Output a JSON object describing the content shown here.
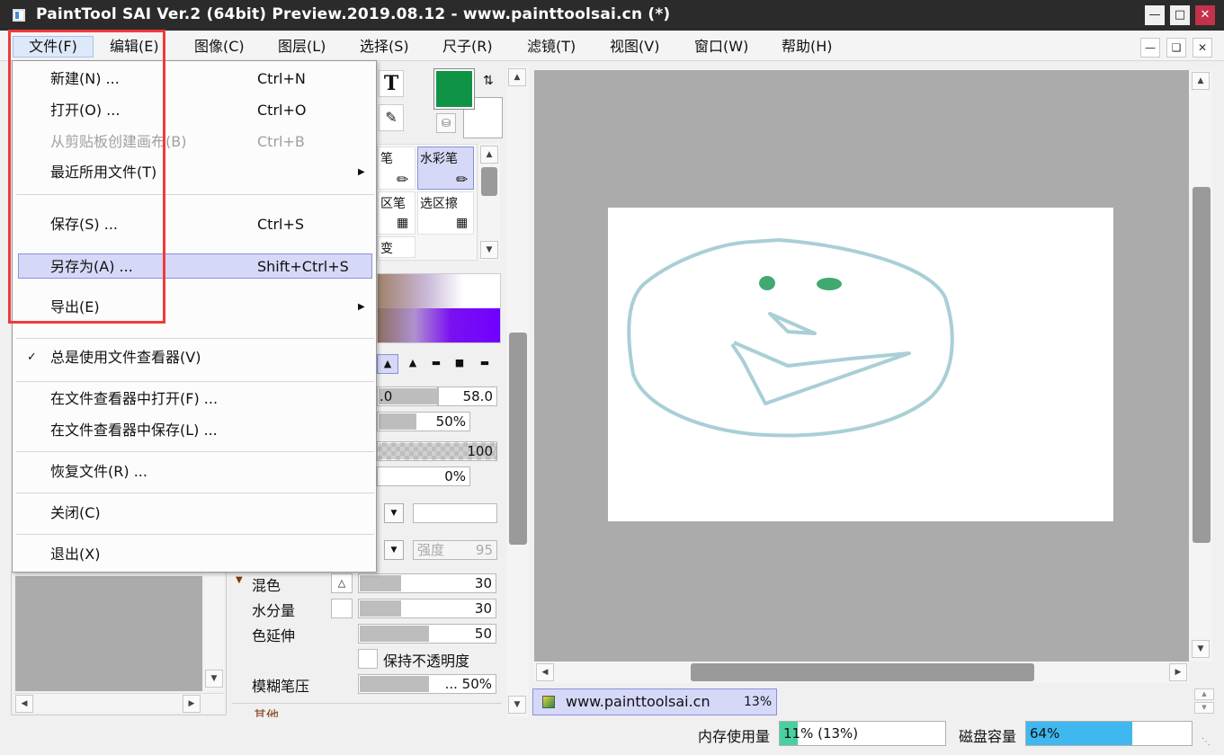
{
  "window": {
    "title": "PaintTool SAI Ver.2 (64bit) Preview.2019.08.12 - www.painttoolsai.cn (*)"
  },
  "menubar": {
    "items": [
      "文件(F)",
      "编辑(E)",
      "图像(C)",
      "图层(L)",
      "选择(S)",
      "尺子(R)",
      "滤镜(T)",
      "视图(V)",
      "窗口(W)",
      "帮助(H)"
    ]
  },
  "file_menu": {
    "new": {
      "label": "新建(N) ...",
      "shortcut": "Ctrl+N"
    },
    "open": {
      "label": "打开(O) ...",
      "shortcut": "Ctrl+O"
    },
    "from_clipboard": {
      "label": "从剪贴板创建画布(B)",
      "shortcut": "Ctrl+B"
    },
    "recent": {
      "label": "最近所用文件(T)"
    },
    "save": {
      "label": "保存(S) ...",
      "shortcut": "Ctrl+S"
    },
    "save_as": {
      "label": "另存为(A) ...",
      "shortcut": "Shift+Ctrl+S"
    },
    "export": {
      "label": "导出(E)"
    },
    "always_viewer": {
      "label": "总是使用文件查看器(V)",
      "checked": true
    },
    "open_in_viewer": {
      "label": "在文件查看器中打开(F) ..."
    },
    "save_in_viewer": {
      "label": "在文件查看器中保存(L) ..."
    },
    "recover": {
      "label": "恢复文件(R) ..."
    },
    "close": {
      "label": "关闭(C)"
    },
    "quit": {
      "label": "退出(X)"
    }
  },
  "tools": {
    "text_tool": "T",
    "brush_partial_1": "笔",
    "watercolor": "水彩笔",
    "select_pen_partial": "区笔",
    "select_eraser": "选区擦",
    "partial_3": "变"
  },
  "colors": {
    "foreground": "#0f9445",
    "background": "#ffffff",
    "highlight": "#d6d8f8",
    "accent_red": "#f03a3a"
  },
  "brush_settings": {
    "size_partial": ".0",
    "size_max": "58.0",
    "density": "50%",
    "opacity": "100",
    "min_size": "0%",
    "strength_label": "强度",
    "strength_value": "95",
    "blend": {
      "label": "混色",
      "value": "30"
    },
    "water": {
      "label": "水分量",
      "value": "30"
    },
    "color_stretch": {
      "label": "色延伸",
      "value": "50"
    },
    "keep_opacity": {
      "label": "保持不透明度"
    },
    "blur_pressure": {
      "label": "模糊笔压",
      "value": "... 50%"
    },
    "other_partial": "其他"
  },
  "document_tab": {
    "name": "www.painttoolsai.cn",
    "zoom": "13%"
  },
  "status": {
    "memory_label": "内存使用量",
    "memory_value": "11% (13%)",
    "memory_fraction": 0.11,
    "disk_label": "磁盘容量",
    "disk_value": "64%",
    "disk_fraction": 0.64
  }
}
